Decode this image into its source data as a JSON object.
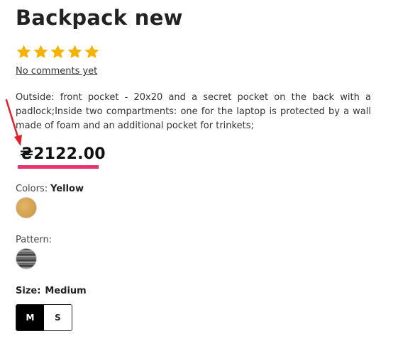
{
  "product": {
    "title": "Backpack new",
    "rating": 5,
    "rating_max": 5,
    "star_color": "#f5b400",
    "comments_link": "No comments yet",
    "description": "Outside: front pocket - 20x20 and a secret pocket on the back with a padlock;Inside two compartments: one for the laptop is protected by a wall made of foam and an additional pocket for trinkets;",
    "price": "₴2122.00"
  },
  "annotation": {
    "arrow_color": "#e0202a",
    "underline_color": "#e8336e"
  },
  "options": {
    "colors": {
      "label": "Colors:",
      "selected": "Yellow",
      "swatches": [
        {
          "name": "Yellow",
          "color": "#d4a24f"
        }
      ]
    },
    "pattern": {
      "label": "Pattern:",
      "swatches": [
        {
          "name": "striped-gray"
        }
      ]
    },
    "size": {
      "label": "Size:",
      "selected": "Medium",
      "buttons": [
        {
          "label": "M",
          "active": true
        },
        {
          "label": "S",
          "active": false
        }
      ]
    }
  }
}
